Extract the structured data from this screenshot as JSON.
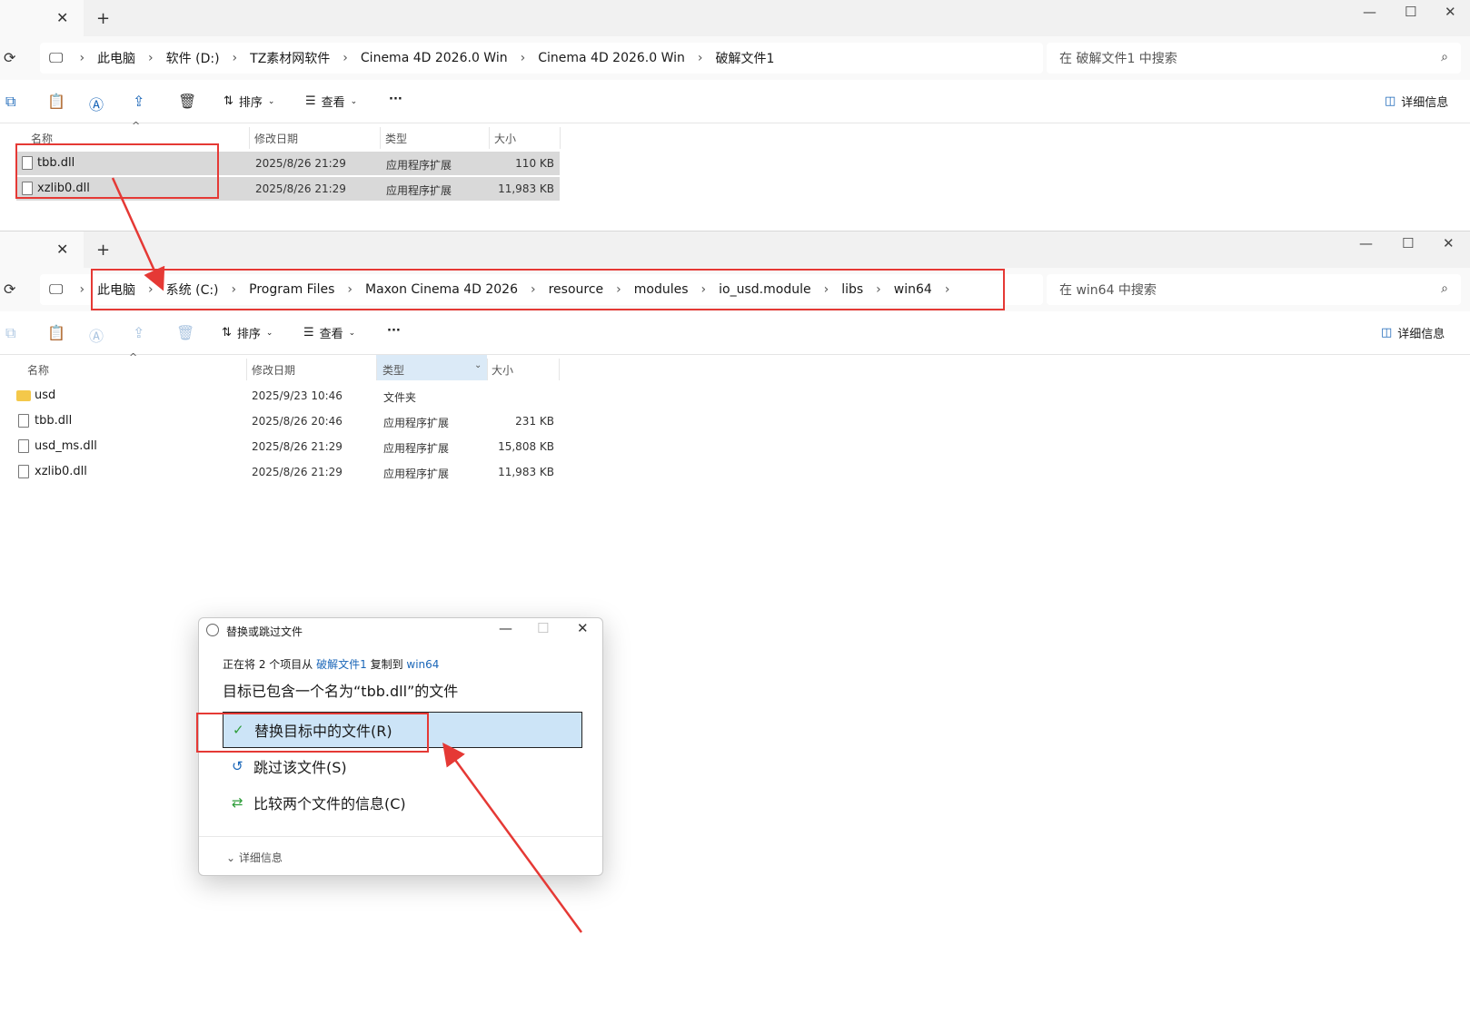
{
  "win1": {
    "tab_close": "✕",
    "tab_new": "+",
    "controls": [
      "—",
      "☐",
      "✕"
    ],
    "breadcrumbs": [
      "此电脑",
      "软件 (D:)",
      "TZ素材网软件",
      "Cinema 4D 2026.0 Win",
      "Cinema 4D 2026.0 Win",
      "破解文件1"
    ],
    "search_placeholder": "在 破解文件1 中搜索",
    "toolbar": {
      "sort": "排序",
      "view": "查看",
      "more": "···",
      "details": "详细信息"
    },
    "columns": [
      "名称",
      "修改日期",
      "类型",
      "大小"
    ],
    "files": [
      {
        "name": "tbb.dll",
        "date": "2025/8/26 21:29",
        "type": "应用程序扩展",
        "size": "110 KB"
      },
      {
        "name": "xzlib0.dll",
        "date": "2025/8/26 21:29",
        "type": "应用程序扩展",
        "size": "11,983 KB"
      }
    ]
  },
  "win2": {
    "tab_close": "✕",
    "tab_new": "+",
    "controls": [
      "—",
      "☐",
      "✕"
    ],
    "breadcrumbs": [
      "此电脑",
      "系统 (C:)",
      "Program Files",
      "Maxon Cinema 4D 2026",
      "resource",
      "modules",
      "io_usd.module",
      "libs",
      "win64"
    ],
    "search_placeholder": "在 win64 中搜索",
    "toolbar": {
      "sort": "排序",
      "view": "查看",
      "more": "···",
      "details": "详细信息"
    },
    "columns": [
      "名称",
      "修改日期",
      "类型",
      "大小"
    ],
    "files": [
      {
        "name": "usd",
        "date": "2025/9/23 10:46",
        "type": "文件夹",
        "size": ""
      },
      {
        "name": "tbb.dll",
        "date": "2025/8/26 20:46",
        "type": "应用程序扩展",
        "size": "231 KB"
      },
      {
        "name": "usd_ms.dll",
        "date": "2025/8/26 21:29",
        "type": "应用程序扩展",
        "size": "15,808 KB"
      },
      {
        "name": "xzlib0.dll",
        "date": "2025/8/26 21:29",
        "type": "应用程序扩展",
        "size": "11,983 KB"
      }
    ]
  },
  "dialog": {
    "title": "替换或跳过文件",
    "info_prefix": "正在将 2 个项目从",
    "info_source": "破解文件1",
    "info_mid": "复制到",
    "info_dest": "win64",
    "headline": "目标已包含一个名为“tbb.dll”的文件",
    "options": [
      "替换目标中的文件(R)",
      "跳过该文件(S)",
      "比较两个文件的信息(C)"
    ],
    "more": "详细信息"
  },
  "colors": {
    "accent": "#1a66b8",
    "highlight": "#e53935",
    "selected": "#cce4f7"
  }
}
